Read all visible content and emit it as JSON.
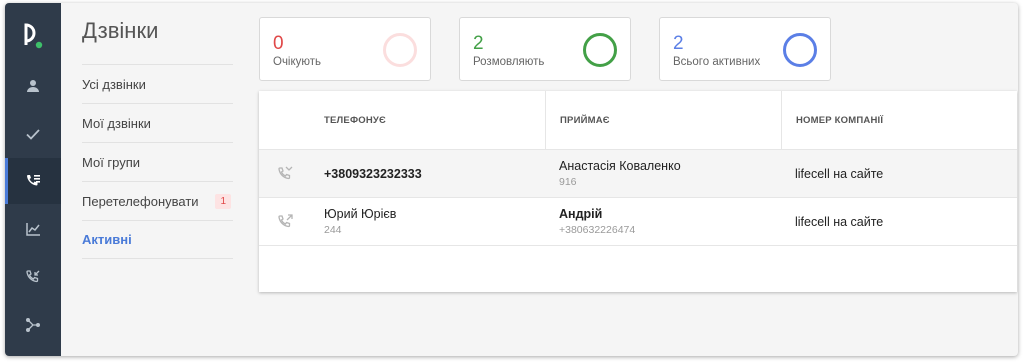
{
  "colors": {
    "rail": "#2f3b4a",
    "accent": "#4a7bd8",
    "waiting": "#e04848",
    "talking": "#43a047",
    "total": "#5b7fe6"
  },
  "rail": {
    "items": [
      {
        "icon": "user-icon"
      },
      {
        "icon": "check-icon"
      },
      {
        "icon": "call-list-icon",
        "active": true
      },
      {
        "icon": "chart-icon"
      },
      {
        "icon": "phone-incoming-icon"
      },
      {
        "icon": "routing-icon"
      }
    ]
  },
  "submenu": {
    "title": "Дзвінки",
    "items": [
      {
        "label": "Усі дзвінки"
      },
      {
        "label": "Мої дзвінки"
      },
      {
        "label": "Мої групи"
      },
      {
        "label": "Перетелефонувати",
        "badge": "1"
      },
      {
        "label": "Активні",
        "active": true
      }
    ]
  },
  "stats": [
    {
      "value": "0",
      "label": "Очікують",
      "color": "#e04848"
    },
    {
      "value": "2",
      "label": "Розмовляють",
      "color": "#43a047"
    },
    {
      "value": "2",
      "label": "Всього активних",
      "color": "#5b7fe6"
    }
  ],
  "table": {
    "headers": {
      "caller": "ТЕЛЕФОНУЄ",
      "receiver": "ПРИЙМАЄ",
      "company": "НОМЕР КОМПАНІЇ"
    },
    "rows": [
      {
        "icon": "call-missed-icon",
        "caller": "+3809323232333",
        "caller_sub": "",
        "receiver": "Анастасія Коваленко",
        "receiver_sub": "916",
        "company": "lifecell на сайте"
      },
      {
        "icon": "call-outgoing-icon",
        "caller": "Юрий Юрієв",
        "caller_sub": "244",
        "receiver": "Андрій",
        "receiver_sub": "+380632226474",
        "company": "lifecell на сайте"
      }
    ]
  }
}
